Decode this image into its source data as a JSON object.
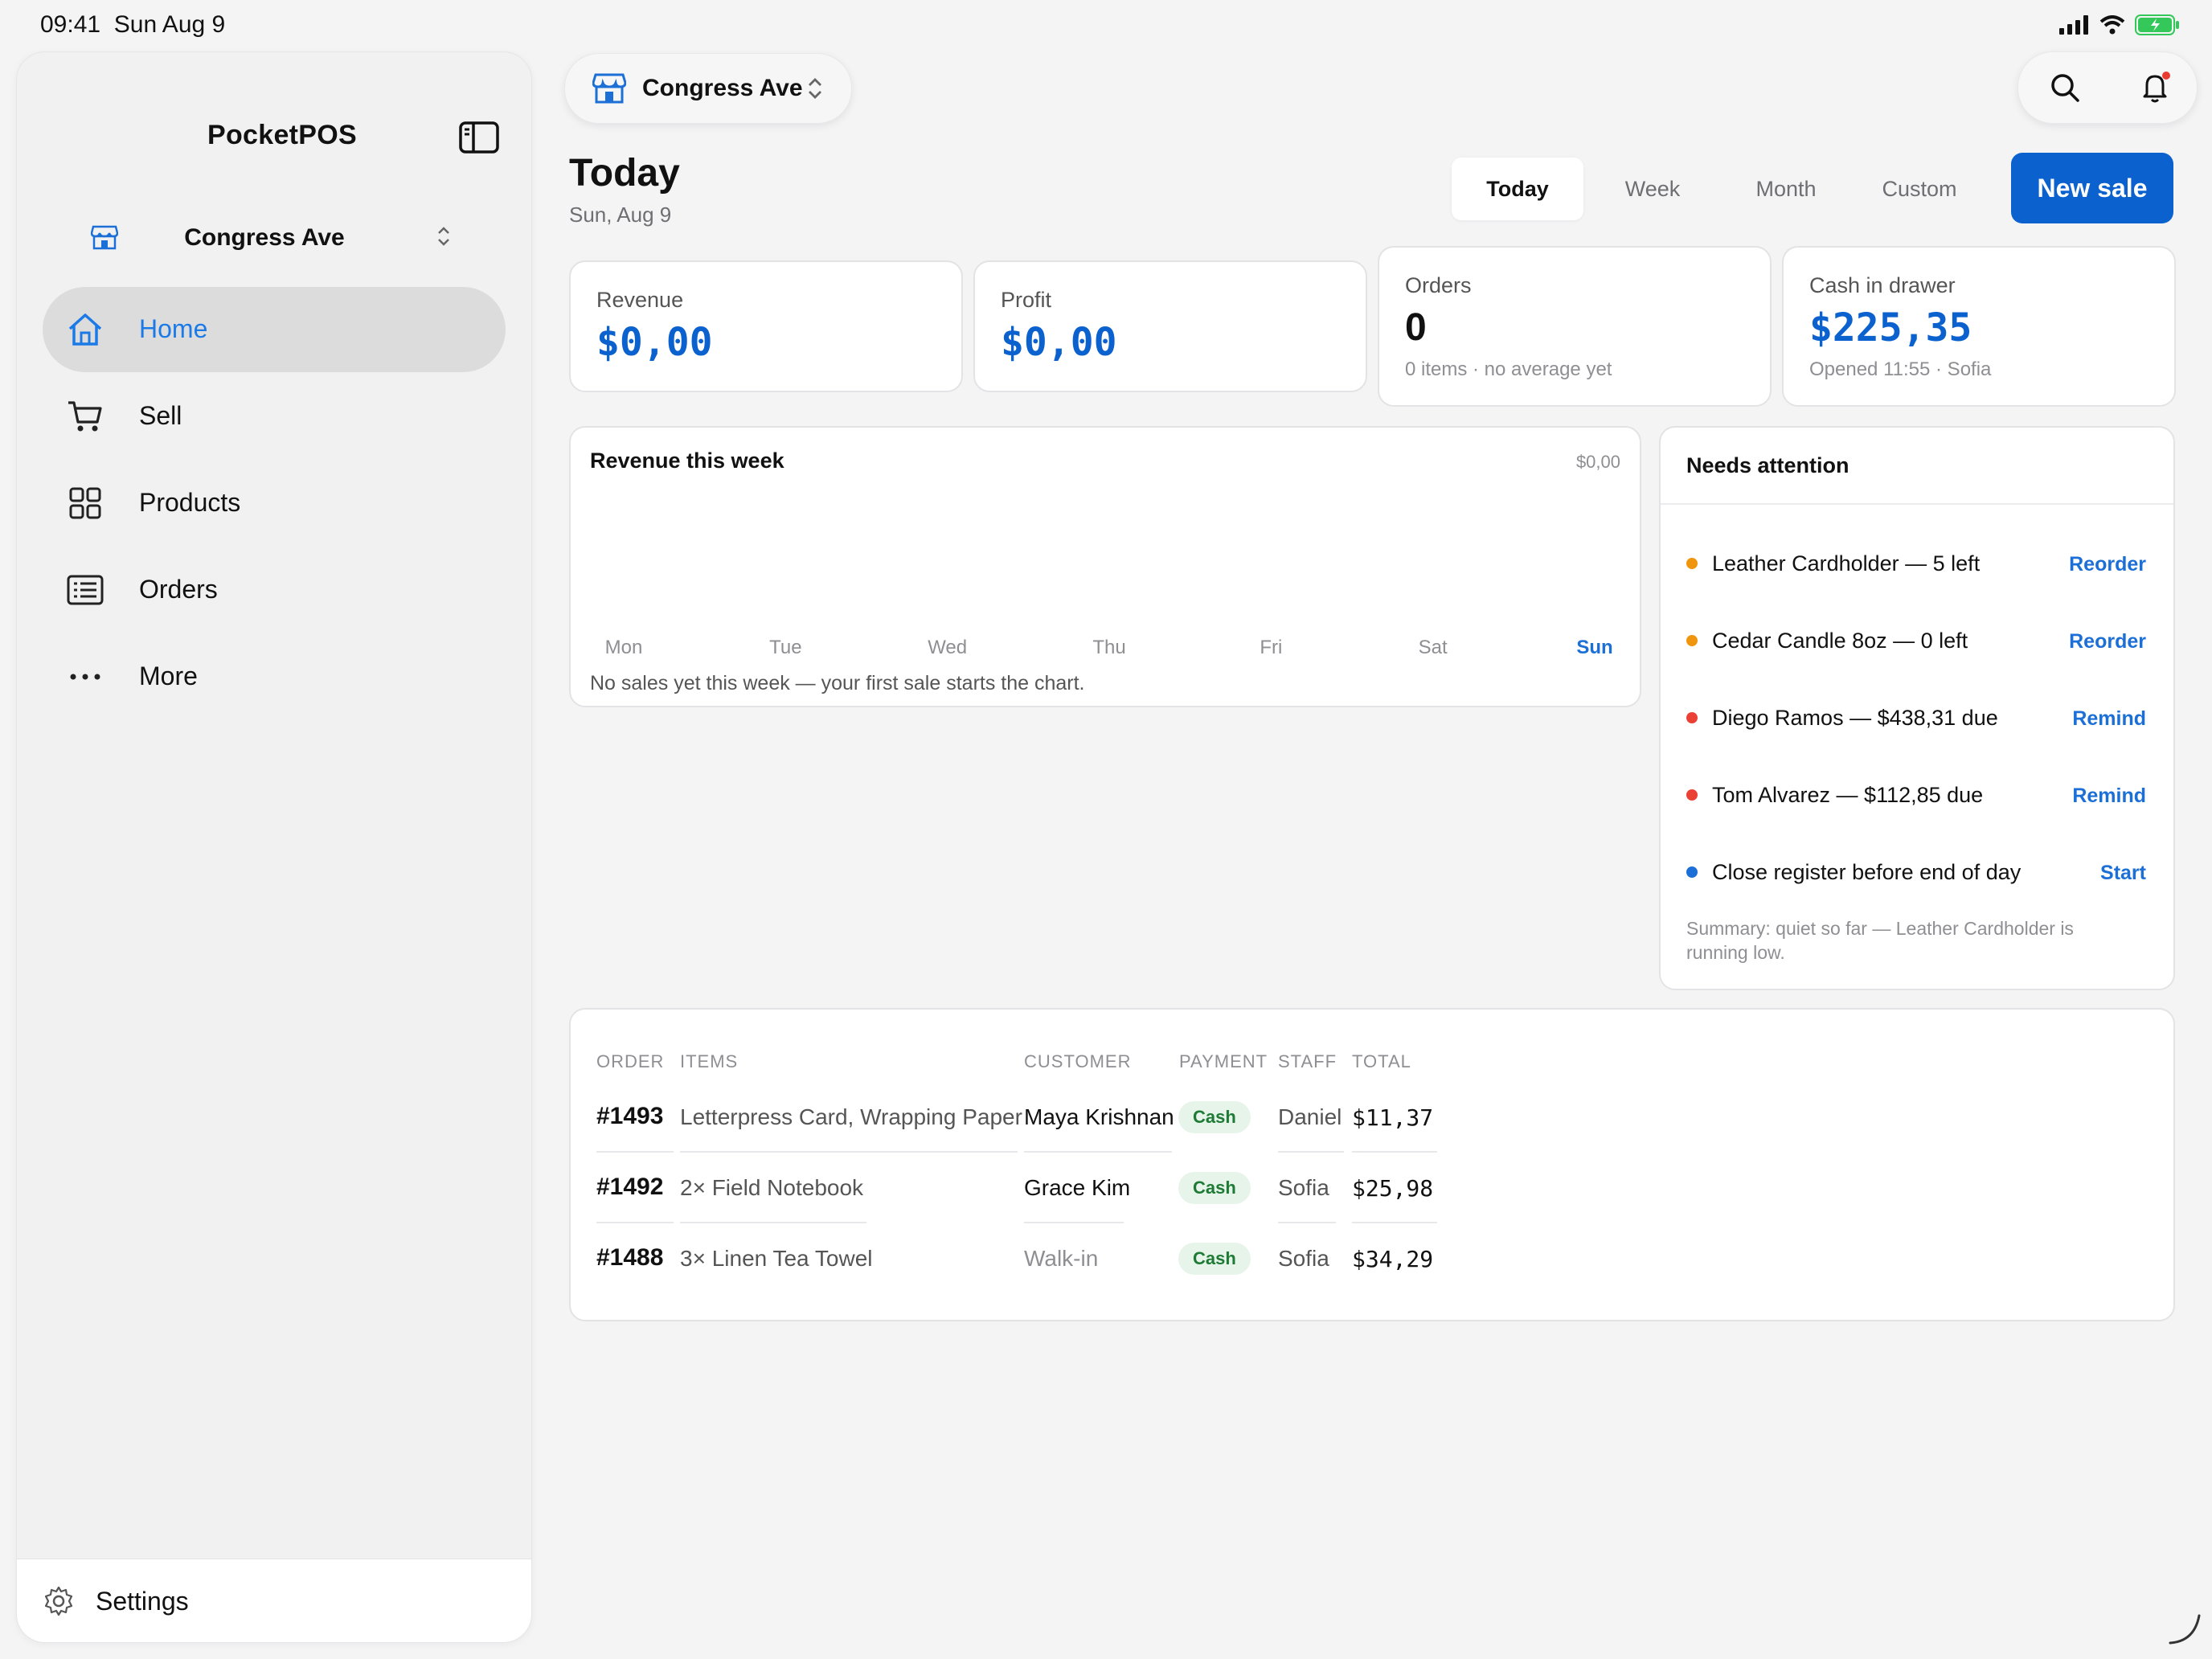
{
  "status_bar": {
    "time": "09:41",
    "date": "Sun Aug 9"
  },
  "sidebar": {
    "app_name": "PocketPOS",
    "store": "Congress Ave",
    "items": [
      {
        "label": "Home",
        "icon": "home-icon",
        "active": true
      },
      {
        "label": "Sell",
        "icon": "cart-icon"
      },
      {
        "label": "Products",
        "icon": "grid-icon"
      },
      {
        "label": "Orders",
        "icon": "list-icon"
      },
      {
        "label": "More",
        "icon": "more-icon"
      }
    ],
    "settings_label": "Settings"
  },
  "topbar": {
    "store": "Congress Ave"
  },
  "header": {
    "title": "Today",
    "date": "Sun, Aug 9",
    "ranges": [
      "Today",
      "Week",
      "Month",
      "Custom"
    ],
    "active_range": "Today",
    "new_sale_label": "New sale"
  },
  "stats": {
    "revenue": {
      "label": "Revenue",
      "value": "$0,00"
    },
    "profit": {
      "label": "Profit",
      "value": "$0,00"
    },
    "orders": {
      "label": "Orders",
      "value": "0",
      "sub": "0 items · no average yet"
    },
    "cash": {
      "label": "Cash in drawer",
      "value": "$225,35",
      "sub": "Opened 11:55 · Sofia"
    }
  },
  "chart_data": {
    "type": "bar",
    "title": "Revenue this week",
    "total": "$0,00",
    "categories": [
      "Mon",
      "Tue",
      "Wed",
      "Thu",
      "Fri",
      "Sat",
      "Sun"
    ],
    "values": [
      0,
      0,
      0,
      0,
      0,
      0,
      0
    ],
    "current": "Sun",
    "note": "No sales yet this week — your first sale starts the chart."
  },
  "attention": {
    "title": "Needs attention",
    "items": [
      {
        "text": "Leather Cardholder — 5 left",
        "action": "Reorder",
        "color": "#f0960e"
      },
      {
        "text": "Cedar Candle 8oz — 0 left",
        "action": "Reorder",
        "color": "#f0960e"
      },
      {
        "text": "Diego Ramos — $438,31 due",
        "action": "Remind",
        "color": "#eb4034"
      },
      {
        "text": "Tom Alvarez — $112,85 due",
        "action": "Remind",
        "color": "#eb4034"
      },
      {
        "text": "Close register before end of day",
        "action": "Start",
        "color": "#1b6fd6"
      }
    ],
    "summary": "Summary: quiet so far — Leather Cardholder is running low."
  },
  "orders_table": {
    "columns": [
      "ORDER",
      "ITEMS",
      "CUSTOMER",
      "PAYMENT",
      "STAFF",
      "TOTAL"
    ],
    "rows": [
      {
        "order": "#1493",
        "items": "Letterpress Card, Wrapping Paper",
        "customer": "Maya Krishnan",
        "payment": "Cash",
        "staff": "Daniel",
        "total": "$11,37"
      },
      {
        "order": "#1492",
        "items": "2× Field Notebook",
        "customer": "Grace Kim",
        "payment": "Cash",
        "staff": "Sofia",
        "total": "$25,98"
      },
      {
        "order": "#1488",
        "items": "3× Linen Tea Towel",
        "customer": "Walk-in",
        "payment": "Cash",
        "staff": "Sofia",
        "total": "$34,29"
      }
    ]
  },
  "colors": {
    "accent": "#0b62cf",
    "link": "#1b6fd6",
    "active_nav": "#1b7ae6",
    "success": "#1e7a34"
  }
}
